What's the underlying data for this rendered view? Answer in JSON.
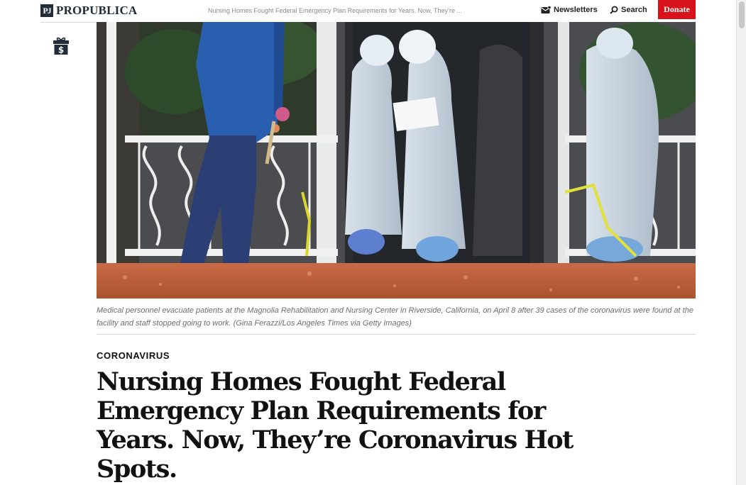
{
  "header": {
    "logo_mark": "PJ",
    "logo_text": "PROPUBLICA",
    "headline_preview": "Nursing Homes Fought Federal Emergency Plan Requirements for Years. Now, They’re ...",
    "newsletters_label": "Newsletters",
    "search_label": "Search",
    "donate_label": "Donate"
  },
  "icons": {
    "gift": "gift-dollar-icon",
    "newsletters": "envelope-icon",
    "search": "search-icon"
  },
  "colors": {
    "brand_navy": "#222c3a",
    "donate_red": "#d8121b"
  },
  "article": {
    "caption": "Medical personnel evacuate patients at the Magnolia Rehabilitation and Nursing Center in Riverside, California, on April 8 after 39 cases of the coronavirus were found at the facility and staff stopped going to work. (Gina Ferazzi/Los Angeles Times via Getty Images)",
    "kicker": "CORONAVIRUS",
    "headline": "Nursing Homes Fought Federal Emergency Plan Requirements for Years. Now, They’re Coronavirus Hot Spots."
  }
}
